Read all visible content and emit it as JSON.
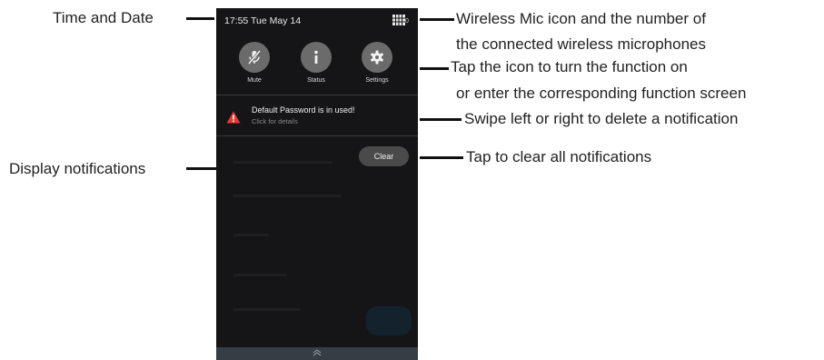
{
  "callouts": {
    "time_date": "Time and Date",
    "wireless_mic_line1": "Wireless Mic icon and the number of",
    "wireless_mic_line2": "the connected wireless microphones",
    "tap_icon_line1": "Tap the icon to turn the function on",
    "tap_icon_line2": "or enter the corresponding function screen",
    "swipe": "Swipe left or right to delete a notification",
    "display_notifications": "Display notifications",
    "tap_clear": "Tap to clear all notifications"
  },
  "status_bar": {
    "time_date": "17:55 Tue May 14",
    "mic_count": "0",
    "mic_icon": "wireless-mic-icon"
  },
  "quick_settings": [
    {
      "label": "Mute",
      "icon": "mic-muted-icon"
    },
    {
      "label": "Status",
      "icon": "info-icon"
    },
    {
      "label": "Settings",
      "icon": "gear-icon"
    }
  ],
  "notification": {
    "title": "Default Password is in used!",
    "subtitle": "Click for details",
    "icon": "warning-icon",
    "icon_color": "#e53935"
  },
  "clear_button": {
    "label": "Clear"
  },
  "colors": {
    "panel_bg": "#151517",
    "tile_bg": "#6b6b6b",
    "bottom_bar": "#343e44",
    "callout_line": "#111111"
  }
}
